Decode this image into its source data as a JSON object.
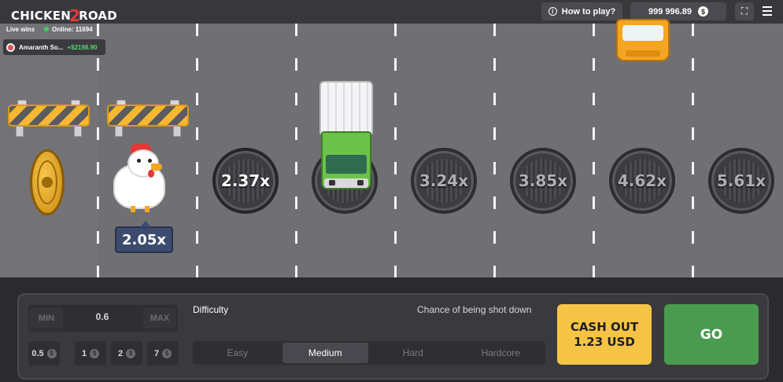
{
  "header": {
    "logo_part1": "CHICKEN",
    "logo_part2": "2",
    "logo_part3": "ROAD",
    "how_to_play": "How to play?",
    "balance": "999 996.89",
    "currency_icon": "$"
  },
  "live": {
    "label": "Live wins",
    "online_label": "Online: 11694",
    "win": {
      "user": "Amaranth So...",
      "amount": "+$2198.90"
    }
  },
  "road": {
    "chicken_multiplier": "2.05x",
    "lanes": [
      {
        "multiplier": "2.37x",
        "state": "active"
      },
      {
        "multiplier": "",
        "state": "blocked"
      },
      {
        "multiplier": "3.24x",
        "state": "inactive"
      },
      {
        "multiplier": "3.85x",
        "state": "inactive"
      },
      {
        "multiplier": "4.62x",
        "state": "inactive"
      },
      {
        "multiplier": "5.61x",
        "state": "inactive"
      }
    ]
  },
  "controls": {
    "min_label": "MIN",
    "max_label": "MAX",
    "bet_value": "0.6",
    "chips": [
      "0.5",
      "1",
      "2",
      "7"
    ],
    "difficulty_label": "Difficulty",
    "chance_label": "Chance of being shot down",
    "difficulties": [
      "Easy",
      "Medium",
      "Hard",
      "Hardcore"
    ],
    "selected_difficulty": "Medium",
    "cashout_line1": "CASH OUT",
    "cashout_line2": "1.23 USD",
    "go_label": "GO"
  },
  "colors": {
    "road": "#706f74",
    "cashout": "#f6c445",
    "go": "#4a9b4f",
    "accent_red": "#e53935"
  }
}
